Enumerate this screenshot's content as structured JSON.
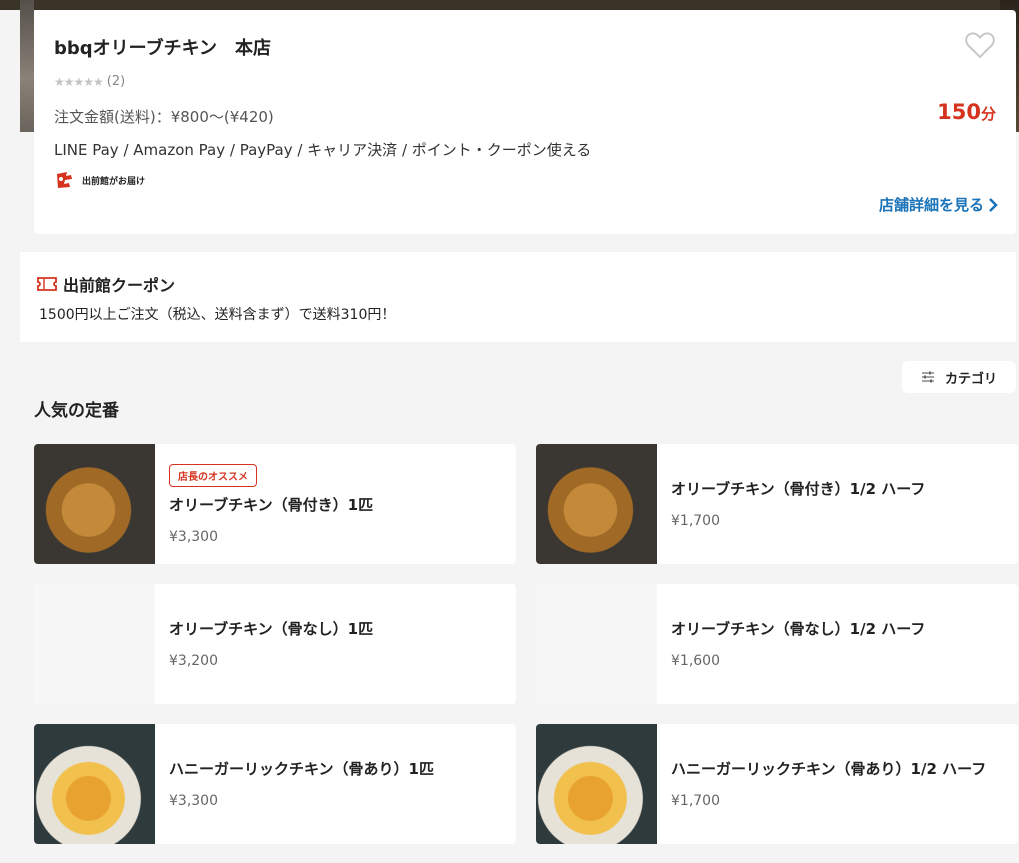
{
  "store": {
    "name": "bbqオリーブチキン　本店",
    "rating_stars": "★★★★★",
    "rating_count": "(2)",
    "fee": "注文金額(送料)：¥800～(¥420)",
    "time_value": "150",
    "time_unit": "分",
    "payment": "LINE Pay / Amazon Pay / PayPay / キャリア決済 / ポイント・クーポン使える",
    "delivery_by": "出前館がお届け",
    "detail_link": "店舗詳細を見る",
    "accent_color": "#d6331f",
    "link_color": "#1a73b8"
  },
  "coupon": {
    "title": "出前館クーポン",
    "description": "1500円以上ご注文（税込、送料含まず）で送料310円！"
  },
  "category": {
    "label": "カテゴリ"
  },
  "section": {
    "title": "人気の定番"
  },
  "menu": [
    {
      "badge": "店長のオススメ",
      "name": "オリーブチキン（骨付き）1匹",
      "price": "¥3,300",
      "image": "fried-chicken"
    },
    {
      "name": "オリーブチキン（骨付き）1/2 ハーフ",
      "price": "¥1,700",
      "image": "fried-chicken"
    },
    {
      "name": "オリーブチキン（骨なし）1匹",
      "price": "¥3,200",
      "image": "placeholder"
    },
    {
      "name": "オリーブチキン（骨なし）1/2 ハーフ",
      "price": "¥1,600",
      "image": "placeholder"
    },
    {
      "name": "ハニーガーリックチキン（骨あり）1匹",
      "price": "¥3,300",
      "image": "honey-garlic-chicken"
    },
    {
      "name": "ハニーガーリックチキン（骨あり）1/2 ハーフ",
      "price": "¥1,700",
      "image": "honey-garlic-chicken"
    }
  ]
}
